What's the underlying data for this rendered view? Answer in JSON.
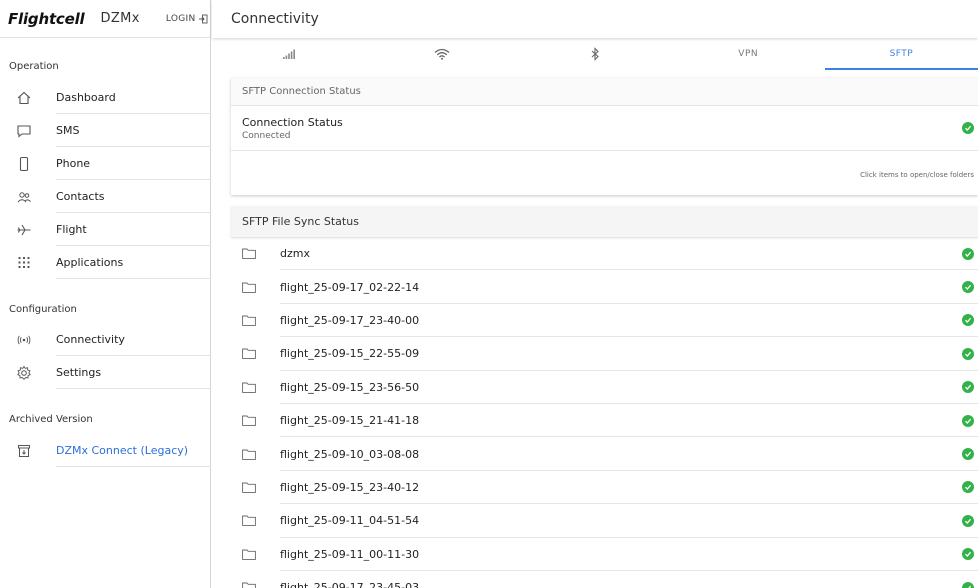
{
  "brand": {
    "logo": "Flightcell",
    "product": "DZMx",
    "login": "LOGIN"
  },
  "header": {
    "title": "Connectivity"
  },
  "sidebar": {
    "sections": [
      {
        "title": "Operation",
        "items": [
          {
            "label": "Dashboard",
            "icon": "home-icon"
          },
          {
            "label": "SMS",
            "icon": "message-icon"
          },
          {
            "label": "Phone",
            "icon": "phone-icon"
          },
          {
            "label": "Contacts",
            "icon": "contacts-icon"
          },
          {
            "label": "Flight",
            "icon": "airplane-icon"
          },
          {
            "label": "Applications",
            "icon": "apps-grid-icon"
          }
        ]
      },
      {
        "title": "Configuration",
        "items": [
          {
            "label": "Connectivity",
            "icon": "broadcast-icon"
          },
          {
            "label": "Settings",
            "icon": "gear-icon"
          }
        ]
      },
      {
        "title": "Archived Version",
        "items": [
          {
            "label": "DZMx Connect (Legacy)",
            "icon": "archive-icon"
          }
        ]
      }
    ]
  },
  "tabs": [
    {
      "label": "",
      "icon": "signal-bars-icon"
    },
    {
      "label": "",
      "icon": "wifi-icon"
    },
    {
      "label": "",
      "icon": "bluetooth-icon"
    },
    {
      "label": "VPN",
      "icon": ""
    },
    {
      "label": "SFTP",
      "icon": "",
      "active": true
    }
  ],
  "connection": {
    "header": "SFTP Connection Status",
    "title": "Connection Status",
    "status": "Connected",
    "hint": "Click items to open/close folders"
  },
  "sync": {
    "header": "SFTP File Sync Status",
    "files": [
      "dzmx",
      "flight_25-09-17_02-22-14",
      "flight_25-09-17_23-40-00",
      "flight_25-09-15_22-55-09",
      "flight_25-09-15_23-56-50",
      "flight_25-09-15_21-41-18",
      "flight_25-09-10_03-08-08",
      "flight_25-09-15_23-40-12",
      "flight_25-09-11_04-51-54",
      "flight_25-09-11_00-11-30",
      "flight_25-09-17_23-45-03"
    ]
  },
  "colors": {
    "accent": "#3b82e0",
    "success": "#34b24a",
    "legacy_link": "#2a6fdb"
  }
}
